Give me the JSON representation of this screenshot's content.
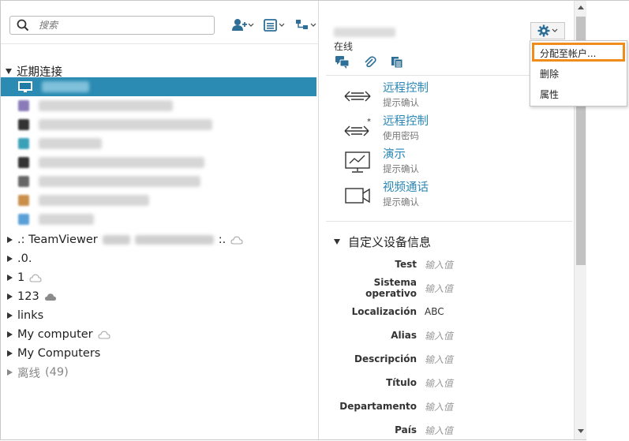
{
  "search": {
    "placeholder": "搜索"
  },
  "recent": {
    "label": "近期连接",
    "rows": [
      {
        "selected": true,
        "icon": "monitor-icon",
        "avatar_color": "#2b8bb2",
        "blur_width": 60
      },
      {
        "selected": false,
        "icon": "avatar",
        "avatar_color": "#8a7ab8",
        "blur_width": 170
      },
      {
        "selected": false,
        "icon": "avatar",
        "avatar_color": "#333333",
        "blur_width": 220
      },
      {
        "selected": false,
        "icon": "avatar",
        "avatar_color": "#3aa0b8",
        "blur_width": 80
      },
      {
        "selected": false,
        "icon": "avatar",
        "avatar_color": "#333333",
        "blur_width": 210
      },
      {
        "selected": false,
        "icon": "avatar",
        "avatar_color": "#666666",
        "blur_width": 205
      },
      {
        "selected": false,
        "icon": "avatar",
        "avatar_color": "#c98f4a",
        "blur_width": 140
      },
      {
        "selected": false,
        "icon": "avatar",
        "avatar_color": "#5aa0d8",
        "blur_width": 70
      }
    ]
  },
  "groups": [
    {
      "label": ".: TeamViewer",
      "suffix": ":.",
      "cloud": "outline",
      "blurred": true
    },
    {
      "label": ".0.",
      "suffix": "",
      "cloud": "none",
      "blurred": false
    },
    {
      "label": "1",
      "suffix": "",
      "cloud": "outline",
      "blurred": false
    },
    {
      "label": "123",
      "suffix": "",
      "cloud": "filled",
      "blurred": false
    },
    {
      "label": "links",
      "suffix": "",
      "cloud": "none",
      "blurred": false
    },
    {
      "label": "My computer",
      "suffix": "",
      "cloud": "outline",
      "blurred": false
    },
    {
      "label": "My Computers",
      "suffix": "",
      "cloud": "none",
      "blurred": false
    },
    {
      "label": "离线",
      "count": "(49)",
      "cloud": "none",
      "blurred": false,
      "dim": true
    }
  ],
  "device": {
    "status": "在线"
  },
  "actions": [
    {
      "title": "远程控制",
      "sub": "提示确认",
      "icon": "remote-control-icon"
    },
    {
      "title": "远程控制",
      "sub": "使用密码",
      "icon": "remote-control-password-icon"
    },
    {
      "title": "演示",
      "sub": "提示确认",
      "icon": "presentation-icon"
    },
    {
      "title": "视频通话",
      "sub": "提示确认",
      "icon": "video-call-icon"
    }
  ],
  "custom_info": {
    "title": "自定义设备信息",
    "props": [
      {
        "key": "Test",
        "value": "输入值",
        "placeholder": true
      },
      {
        "key": "Sistema operativo",
        "value": "输入值",
        "placeholder": true
      },
      {
        "key": "Localización",
        "value": "ABC",
        "placeholder": false
      },
      {
        "key": "Alias",
        "value": "输入值",
        "placeholder": true
      },
      {
        "key": "Descripción",
        "value": "输入值",
        "placeholder": true
      },
      {
        "key": "Título",
        "value": "输入值",
        "placeholder": true
      },
      {
        "key": "Departamento",
        "value": "输入值",
        "placeholder": true
      },
      {
        "key": "País",
        "value": "输入值",
        "placeholder": true
      }
    ]
  },
  "context_menu": {
    "items": [
      "分配至帐户...",
      "删除",
      "属性"
    ],
    "highlighted": 0
  },
  "colors": {
    "accent": "#2b8bb2",
    "link": "#2a86b4",
    "highlight_border": "#f08c1c"
  }
}
